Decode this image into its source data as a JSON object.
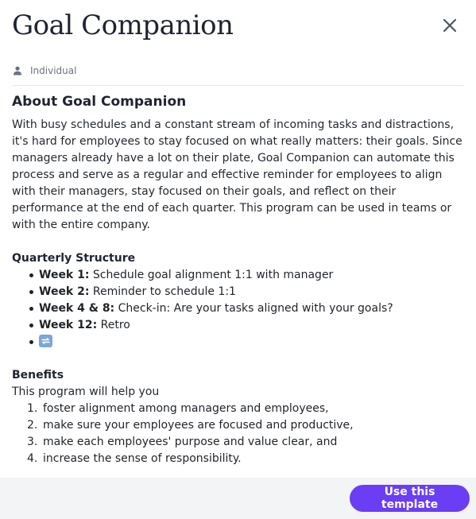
{
  "modal": {
    "title": "Goal Companion",
    "audience_label": "Individual",
    "close_label": "Close"
  },
  "about": {
    "heading": "About Goal Companion",
    "description": "With busy schedules and a constant stream of incoming tasks and distractions, it's hard for employees to stay focused on what really matters: their goals. Since managers already have a lot on their plate, Goal Companion can automate this process and serve as a regular and effective reminder for employees to align with their managers, stay focused on their goals, and reflect on their performance at the end of each quarter. This program can be used in teams or with the entire company."
  },
  "structure": {
    "heading": "Quarterly Structure",
    "items": [
      {
        "label": "Week 1:",
        "text": " Schedule goal alignment 1:1 with manager"
      },
      {
        "label": "Week 2:",
        "text": " Reminder to schedule 1:1"
      },
      {
        "label": "Week 4 & 8:",
        "text": " Check-in: Are your tasks aligned with your goals?"
      },
      {
        "label": "Week 12:",
        "text": " Retro"
      }
    ],
    "last_item_icon": "repeat-emoji-icon"
  },
  "benefits": {
    "heading": "Benefits",
    "intro": "This program will help you",
    "items": [
      {
        "num": "1.",
        "text": "foster alignment among managers and employees,"
      },
      {
        "num": "2.",
        "text": "make sure your employees are focused and productive,"
      },
      {
        "num": "3.",
        "text": "make each employees' purpose and value clear, and"
      },
      {
        "num": "4.",
        "text": "increase the sense of responsibility."
      }
    ]
  },
  "footer": {
    "cta_label": "Use this template"
  },
  "colors": {
    "accent": "#6b3df5",
    "footer_bg": "#f3f4f6"
  }
}
